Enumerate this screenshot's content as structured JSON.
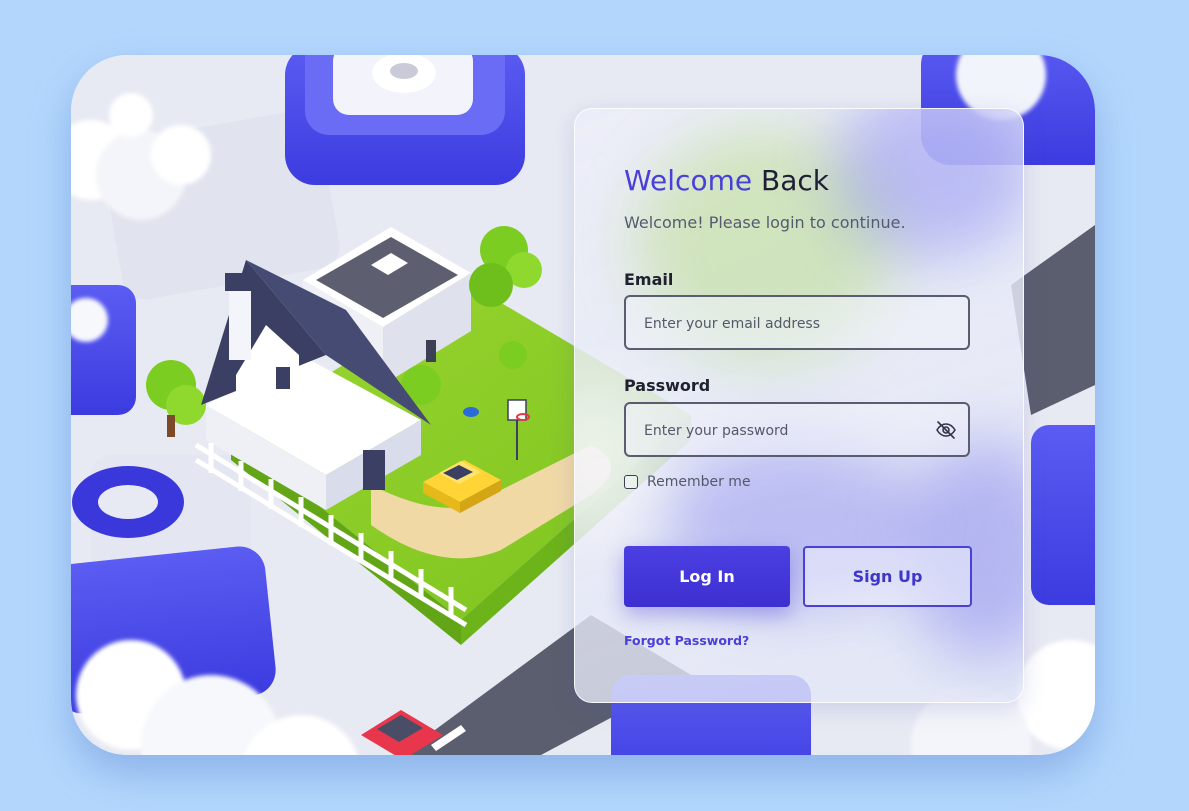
{
  "login": {
    "title_accent": "Welcome",
    "title_rest": "Back",
    "subtitle": "Welcome! Please login to continue.",
    "email_label": "Email",
    "email_placeholder": "Enter your email address",
    "password_label": "Password",
    "password_placeholder": "Enter your password",
    "remember_label": "Remember me",
    "remember_checked": false,
    "login_button": "Log In",
    "signup_button": "Sign Up",
    "forgot_link": "Forgot Password?"
  },
  "icons": {
    "password_toggle": "eye-off-icon"
  },
  "colors": {
    "page_background": "#b3d7fc",
    "accent": "#4a3fd8",
    "primary_button": "#4537dc",
    "lawn": "#8fcf2e",
    "roof": "#3b3f63",
    "car": "#ffd437"
  }
}
